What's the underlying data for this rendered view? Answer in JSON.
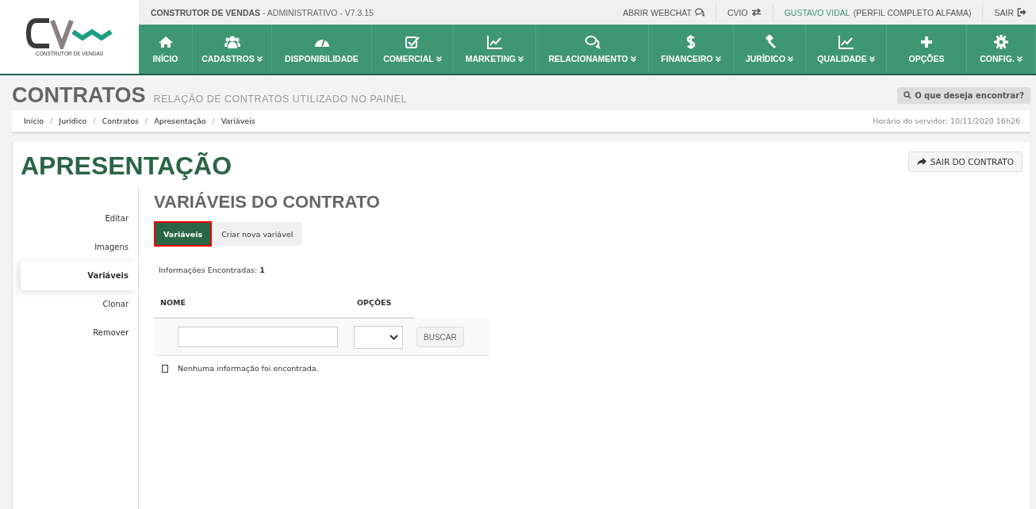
{
  "logo": {
    "subtitle": "CONSTRUTOR DE VENDAS"
  },
  "top_bar": {
    "app_name": "CONSTRUTOR DE VENDAS",
    "app_info": " - ADMINISTRATIVO - V7.3.15",
    "links": [
      {
        "label": "ABRIR WEBCHAT",
        "kind": "chat"
      },
      {
        "label": "CVIO",
        "kind": "swap"
      }
    ],
    "user": {
      "name": "GUSTAVO VIDAL",
      "profile": "(PERFIL COMPLETO ALFAMA)"
    },
    "logout": "SAIR"
  },
  "nav": [
    {
      "label": "INÍCIO",
      "dropdown": false
    },
    {
      "label": "CADASTROS",
      "dropdown": true
    },
    {
      "label": "DISPONIBILIDADE",
      "dropdown": false
    },
    {
      "label": "COMERCIAL",
      "dropdown": true
    },
    {
      "label": "MARKETING",
      "dropdown": true
    },
    {
      "label": "RELACIONAMENTO",
      "dropdown": true
    },
    {
      "label": "FINANCEIRO",
      "dropdown": true
    },
    {
      "label": "JURÍDICO",
      "dropdown": true
    },
    {
      "label": "QUALIDADE",
      "dropdown": true
    },
    {
      "label": "OPÇÕES",
      "dropdown": false
    },
    {
      "label": "CONFIG.",
      "dropdown": true
    }
  ],
  "page_header": {
    "title": "CONTRATOS",
    "subtitle": "RELAÇÃO DE CONTRATOS UTILIZADO NO PAINEL",
    "search_button": "O que deseja encontrar?"
  },
  "breadcrumb": {
    "separator": "/",
    "items": [
      "Início",
      "Jurídico",
      "Contratos",
      "Apresentação",
      "Variáveis"
    ]
  },
  "server_time": "Horário do servidor: 10/11/2020 16h26",
  "card": {
    "title": "APRESENTAÇÃO",
    "exit_button": "SAIR DO CONTRATO"
  },
  "side_menu": [
    {
      "label": "Editar",
      "selected": false
    },
    {
      "label": "Imagens",
      "selected": false
    },
    {
      "label": "Variáveis",
      "selected": true
    },
    {
      "label": "Clonar",
      "selected": false
    },
    {
      "label": "Remover",
      "selected": false
    }
  ],
  "section_title": "VARIÁVEIS DO CONTRATO",
  "tabs": [
    {
      "label": "Variáveis",
      "selected": true
    },
    {
      "label": "Criar nova variável",
      "selected": false
    }
  ],
  "results": {
    "label": "Informações Encontradas:",
    "count": "1"
  },
  "table": {
    "columns": [
      "NOME",
      "OPÇÕES"
    ],
    "search_button": "BUSCAR",
    "empty_message": "Nenhuma informação foi encontrada."
  }
}
